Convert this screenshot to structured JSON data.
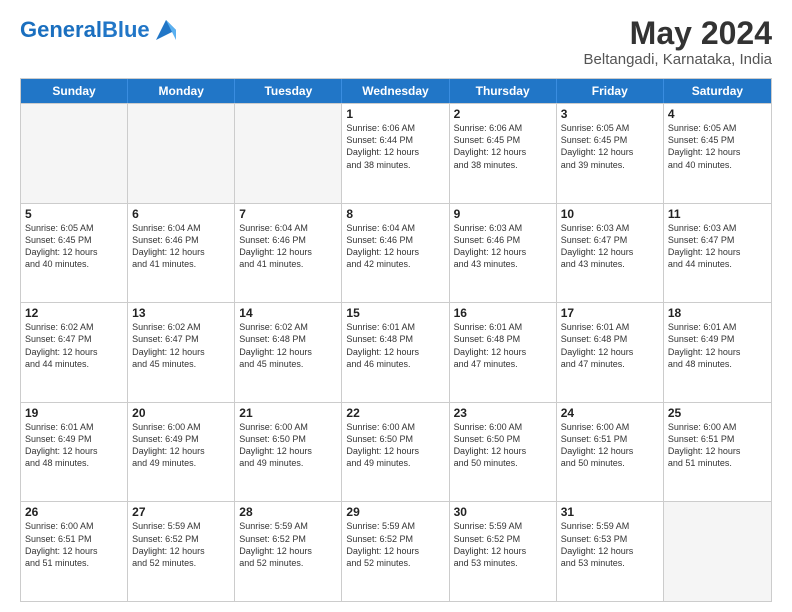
{
  "header": {
    "logo_general": "General",
    "logo_blue": "Blue",
    "title": "May 2024",
    "subtitle": "Beltangadi, Karnataka, India"
  },
  "weekdays": [
    "Sunday",
    "Monday",
    "Tuesday",
    "Wednesday",
    "Thursday",
    "Friday",
    "Saturday"
  ],
  "rows": [
    [
      {
        "day": "",
        "info": "",
        "empty": true
      },
      {
        "day": "",
        "info": "",
        "empty": true
      },
      {
        "day": "",
        "info": "",
        "empty": true
      },
      {
        "day": "1",
        "info": "Sunrise: 6:06 AM\nSunset: 6:44 PM\nDaylight: 12 hours\nand 38 minutes.",
        "empty": false
      },
      {
        "day": "2",
        "info": "Sunrise: 6:06 AM\nSunset: 6:45 PM\nDaylight: 12 hours\nand 38 minutes.",
        "empty": false
      },
      {
        "day": "3",
        "info": "Sunrise: 6:05 AM\nSunset: 6:45 PM\nDaylight: 12 hours\nand 39 minutes.",
        "empty": false
      },
      {
        "day": "4",
        "info": "Sunrise: 6:05 AM\nSunset: 6:45 PM\nDaylight: 12 hours\nand 40 minutes.",
        "empty": false
      }
    ],
    [
      {
        "day": "5",
        "info": "Sunrise: 6:05 AM\nSunset: 6:45 PM\nDaylight: 12 hours\nand 40 minutes.",
        "empty": false
      },
      {
        "day": "6",
        "info": "Sunrise: 6:04 AM\nSunset: 6:46 PM\nDaylight: 12 hours\nand 41 minutes.",
        "empty": false
      },
      {
        "day": "7",
        "info": "Sunrise: 6:04 AM\nSunset: 6:46 PM\nDaylight: 12 hours\nand 41 minutes.",
        "empty": false
      },
      {
        "day": "8",
        "info": "Sunrise: 6:04 AM\nSunset: 6:46 PM\nDaylight: 12 hours\nand 42 minutes.",
        "empty": false
      },
      {
        "day": "9",
        "info": "Sunrise: 6:03 AM\nSunset: 6:46 PM\nDaylight: 12 hours\nand 43 minutes.",
        "empty": false
      },
      {
        "day": "10",
        "info": "Sunrise: 6:03 AM\nSunset: 6:47 PM\nDaylight: 12 hours\nand 43 minutes.",
        "empty": false
      },
      {
        "day": "11",
        "info": "Sunrise: 6:03 AM\nSunset: 6:47 PM\nDaylight: 12 hours\nand 44 minutes.",
        "empty": false
      }
    ],
    [
      {
        "day": "12",
        "info": "Sunrise: 6:02 AM\nSunset: 6:47 PM\nDaylight: 12 hours\nand 44 minutes.",
        "empty": false
      },
      {
        "day": "13",
        "info": "Sunrise: 6:02 AM\nSunset: 6:47 PM\nDaylight: 12 hours\nand 45 minutes.",
        "empty": false
      },
      {
        "day": "14",
        "info": "Sunrise: 6:02 AM\nSunset: 6:48 PM\nDaylight: 12 hours\nand 45 minutes.",
        "empty": false
      },
      {
        "day": "15",
        "info": "Sunrise: 6:01 AM\nSunset: 6:48 PM\nDaylight: 12 hours\nand 46 minutes.",
        "empty": false
      },
      {
        "day": "16",
        "info": "Sunrise: 6:01 AM\nSunset: 6:48 PM\nDaylight: 12 hours\nand 47 minutes.",
        "empty": false
      },
      {
        "day": "17",
        "info": "Sunrise: 6:01 AM\nSunset: 6:48 PM\nDaylight: 12 hours\nand 47 minutes.",
        "empty": false
      },
      {
        "day": "18",
        "info": "Sunrise: 6:01 AM\nSunset: 6:49 PM\nDaylight: 12 hours\nand 48 minutes.",
        "empty": false
      }
    ],
    [
      {
        "day": "19",
        "info": "Sunrise: 6:01 AM\nSunset: 6:49 PM\nDaylight: 12 hours\nand 48 minutes.",
        "empty": false
      },
      {
        "day": "20",
        "info": "Sunrise: 6:00 AM\nSunset: 6:49 PM\nDaylight: 12 hours\nand 49 minutes.",
        "empty": false
      },
      {
        "day": "21",
        "info": "Sunrise: 6:00 AM\nSunset: 6:50 PM\nDaylight: 12 hours\nand 49 minutes.",
        "empty": false
      },
      {
        "day": "22",
        "info": "Sunrise: 6:00 AM\nSunset: 6:50 PM\nDaylight: 12 hours\nand 49 minutes.",
        "empty": false
      },
      {
        "day": "23",
        "info": "Sunrise: 6:00 AM\nSunset: 6:50 PM\nDaylight: 12 hours\nand 50 minutes.",
        "empty": false
      },
      {
        "day": "24",
        "info": "Sunrise: 6:00 AM\nSunset: 6:51 PM\nDaylight: 12 hours\nand 50 minutes.",
        "empty": false
      },
      {
        "day": "25",
        "info": "Sunrise: 6:00 AM\nSunset: 6:51 PM\nDaylight: 12 hours\nand 51 minutes.",
        "empty": false
      }
    ],
    [
      {
        "day": "26",
        "info": "Sunrise: 6:00 AM\nSunset: 6:51 PM\nDaylight: 12 hours\nand 51 minutes.",
        "empty": false
      },
      {
        "day": "27",
        "info": "Sunrise: 5:59 AM\nSunset: 6:52 PM\nDaylight: 12 hours\nand 52 minutes.",
        "empty": false
      },
      {
        "day": "28",
        "info": "Sunrise: 5:59 AM\nSunset: 6:52 PM\nDaylight: 12 hours\nand 52 minutes.",
        "empty": false
      },
      {
        "day": "29",
        "info": "Sunrise: 5:59 AM\nSunset: 6:52 PM\nDaylight: 12 hours\nand 52 minutes.",
        "empty": false
      },
      {
        "day": "30",
        "info": "Sunrise: 5:59 AM\nSunset: 6:52 PM\nDaylight: 12 hours\nand 53 minutes.",
        "empty": false
      },
      {
        "day": "31",
        "info": "Sunrise: 5:59 AM\nSunset: 6:53 PM\nDaylight: 12 hours\nand 53 minutes.",
        "empty": false
      },
      {
        "day": "",
        "info": "",
        "empty": true
      }
    ]
  ]
}
